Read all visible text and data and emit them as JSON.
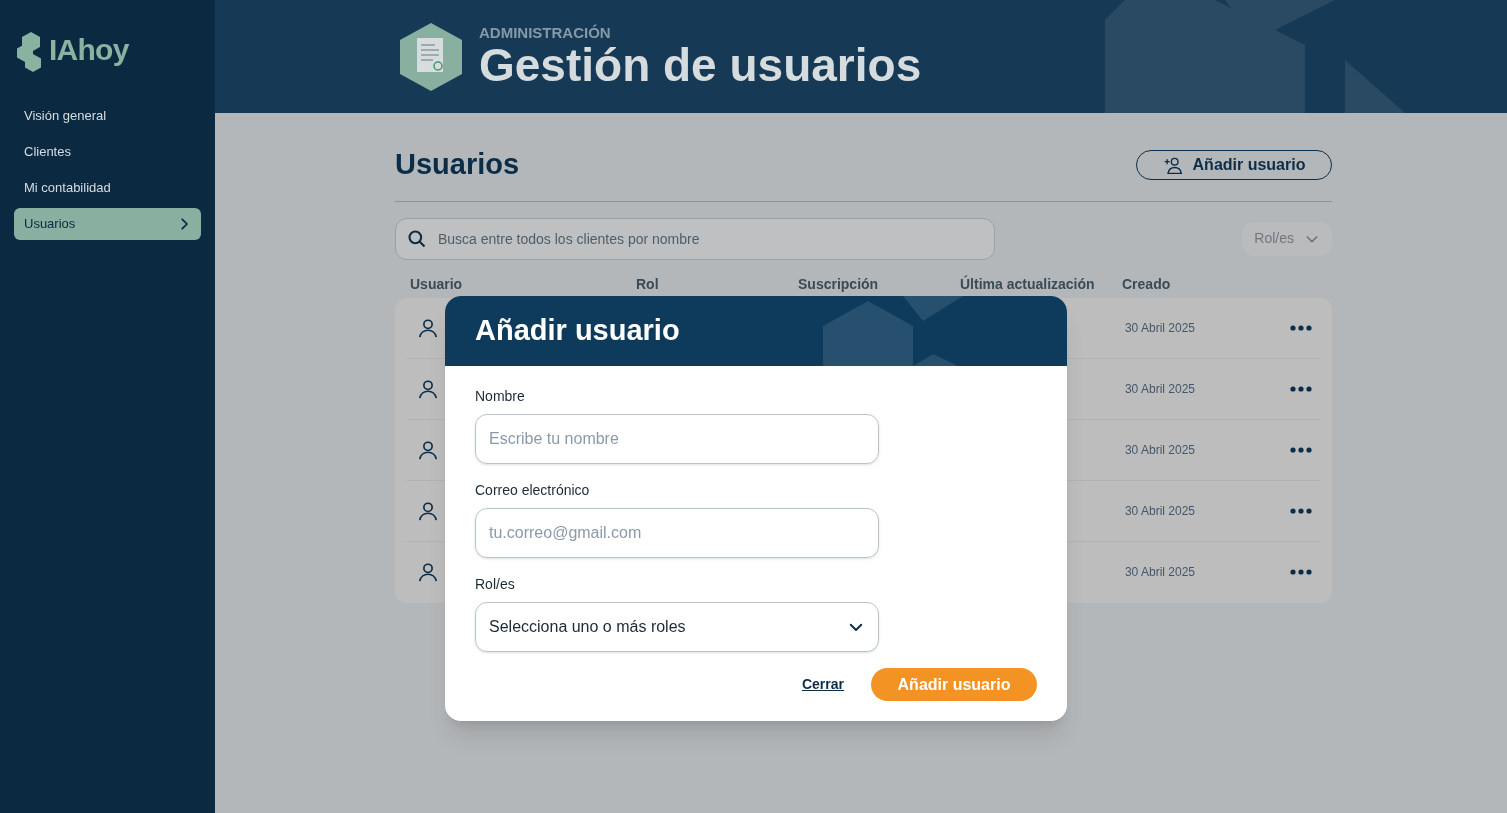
{
  "brand": {
    "name": "IAhoy"
  },
  "sidebar": {
    "items": [
      {
        "label": "Visión general",
        "selected": false
      },
      {
        "label": "Clientes",
        "selected": false
      },
      {
        "label": "Mi contabilidad",
        "selected": false
      },
      {
        "label": "Usuarios",
        "selected": true
      }
    ]
  },
  "header": {
    "eyebrow": "ADMINISTRACIÓN",
    "title": "Gestión de usuarios"
  },
  "page": {
    "title": "Usuarios",
    "add_button": "Añadir usuario",
    "search": {
      "placeholder": "Busca entre todos los clientes por nombre"
    },
    "role_filter": "Rol/es"
  },
  "table": {
    "columns": [
      "Usuario",
      "Rol",
      "Suscripción",
      "Última actualización",
      "Creado"
    ],
    "rows": [
      {
        "created": "30 Abril 2025"
      },
      {
        "created": "30 Abril 2025"
      },
      {
        "created": "30 Abril 2025"
      },
      {
        "created": "30 Abril 2025"
      },
      {
        "created": "30 Abril 2025"
      }
    ]
  },
  "modal": {
    "title": "Añadir usuario",
    "fields": [
      {
        "label": "Nombre",
        "kind": "text",
        "placeholder": "Escribe tu nombre"
      },
      {
        "label": "Correo electrónico",
        "kind": "text",
        "placeholder": "tu.correo@gmail.com"
      },
      {
        "label": "Rol/es",
        "kind": "select",
        "value": "Selecciona uno o más roles"
      }
    ],
    "cancel": "Cerrar",
    "submit": "Añadir usuario"
  }
}
